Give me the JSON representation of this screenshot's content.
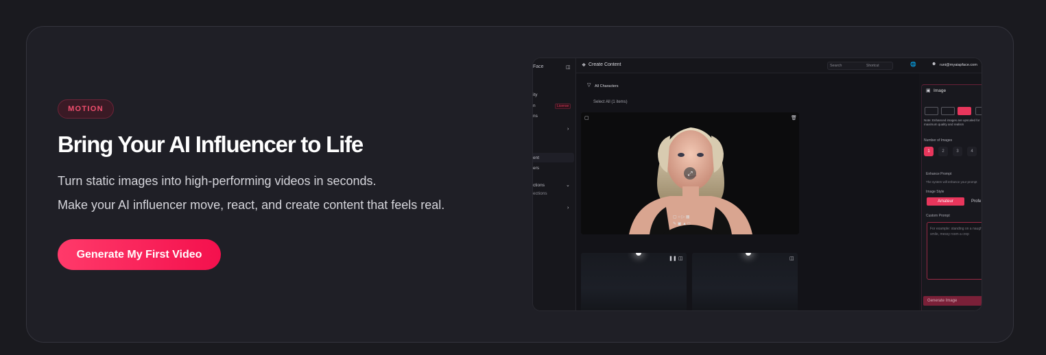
{
  "hero": {
    "badge": "MOTION",
    "headline": "Bring Your AI Influencer to Life",
    "subtext_1": "Turn static images into high-performing videos in seconds.",
    "subtext_2": "Make your AI influencer move, react, and create content that feels real.",
    "cta": "Generate My First Video"
  },
  "screenshot": {
    "sidebar": {
      "brand": "Face",
      "items": [
        "ity",
        "n",
        "ns",
        "ent",
        "ers",
        "ctions",
        "ections"
      ],
      "badge": "License"
    },
    "topbar": {
      "title": "Create Content",
      "search_placeholder": "Search",
      "search_hint": "Shortcut",
      "email": "runi@myaiapface.com"
    },
    "filter": "All Characters",
    "select_all": "Select All (1 items)",
    "panel": {
      "title": "Image",
      "note": "Note: Enhanced images are upscaled for maximum quality and realism",
      "num_label": "Number of Images",
      "numbers": [
        "1",
        "2",
        "3",
        "4"
      ],
      "enhance_label": "Enhance Prompt",
      "enhance_desc": "The system will enhance your prompt",
      "style_label": "Image Style",
      "style_on": "Amateur",
      "style_off": "Profe",
      "custom_label": "Custom Prompt",
      "custom_placeholder": "For example: standing on a naughty smile, messy room a crop",
      "generate": "Generate Image"
    },
    "colors": {
      "accent": "#e8365c",
      "cta": "#ff2d5e"
    }
  }
}
